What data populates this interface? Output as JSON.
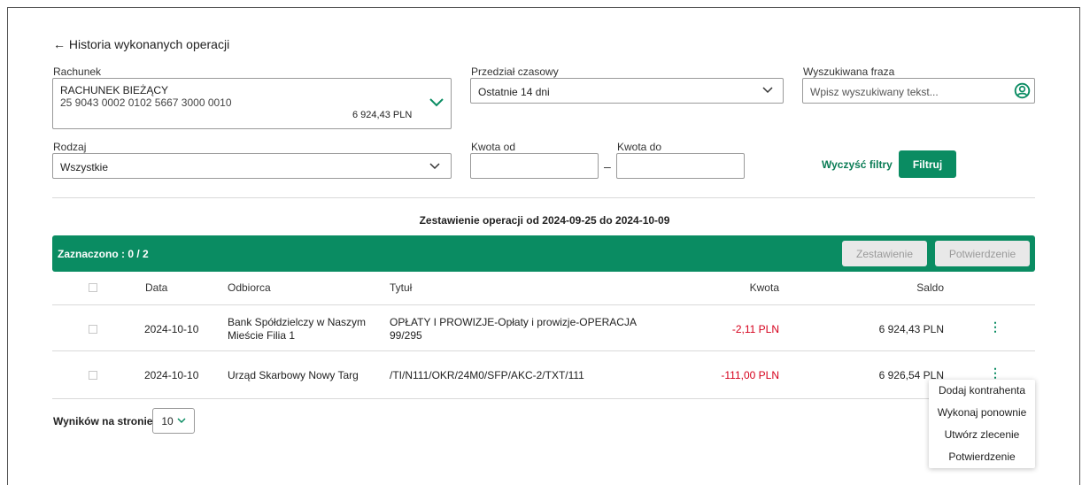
{
  "page": {
    "back_label": "← Historia wykonanych operacji"
  },
  "filters": {
    "account": {
      "label": "Rachunek",
      "name": "RACHUNEK BIEŻĄCY",
      "number": "25 9043 0002 0102 5667 3000 0010",
      "balance": "6 924,43 PLN"
    },
    "period": {
      "label": "Przedział czasowy",
      "value": "Ostatnie 14 dni"
    },
    "search": {
      "label": "Wyszukiwana fraza",
      "placeholder": "Wpisz wyszukiwany tekst..."
    },
    "type": {
      "label": "Rodzaj",
      "value": "Wszystkie"
    },
    "amount_from": {
      "label": "Kwota od",
      "value": ""
    },
    "amount_separator": "–",
    "amount_to": {
      "label": "Kwota do",
      "value": ""
    },
    "clear_label": "Wyczyść filtry",
    "filter_label": "Filtruj"
  },
  "summary": {
    "title": "Zestawienie operacji od 2024-09-25 do 2024-10-09"
  },
  "selection_bar": {
    "selected_text": "Zaznaczono : 0 / 2",
    "statement_button": "Zestawienie",
    "confirmation_button": "Potwierdzenie"
  },
  "table": {
    "headers": {
      "date": "Data",
      "recipient": "Odbiorca",
      "title": "Tytuł",
      "amount": "Kwota",
      "balance": "Saldo"
    },
    "rows": [
      {
        "date": "2024-10-10",
        "recipient_line1": "Bank Spółdzielczy w Naszym",
        "recipient_line2": "Mieście Filia 1",
        "title_line1": "OPŁATY I PROWIZJE-Opłaty i prowizje-OPERACJA",
        "title_line2": "99/295",
        "amount": "-2,11 PLN",
        "balance": "6 924,43 PLN"
      },
      {
        "date": "2024-10-10",
        "recipient_line1": "Urząd Skarbowy Nowy Targ",
        "recipient_line2": "",
        "title_line1": "/TI/N111/OKR/24M0/SFP/AKC-2/TXT/111",
        "title_line2": "",
        "amount": "-111,00 PLN",
        "balance": "6 926,54 PLN"
      }
    ]
  },
  "pagination": {
    "label": "Wyników na stronie",
    "value": "10"
  },
  "context_menu": {
    "items": [
      "Dodaj kontrahenta",
      "Wykonaj ponownie",
      "Utwórz zlecenie",
      "Potwierdzenie"
    ]
  },
  "colors": {
    "primary_green": "#0a8c62",
    "negative_red": "#d6001c",
    "disabled_grey": "#e8e8e8"
  },
  "icons": {
    "chevron": "chevron-down-icon",
    "search": "user-circle-icon",
    "kebab": "kebab-menu-icon"
  }
}
